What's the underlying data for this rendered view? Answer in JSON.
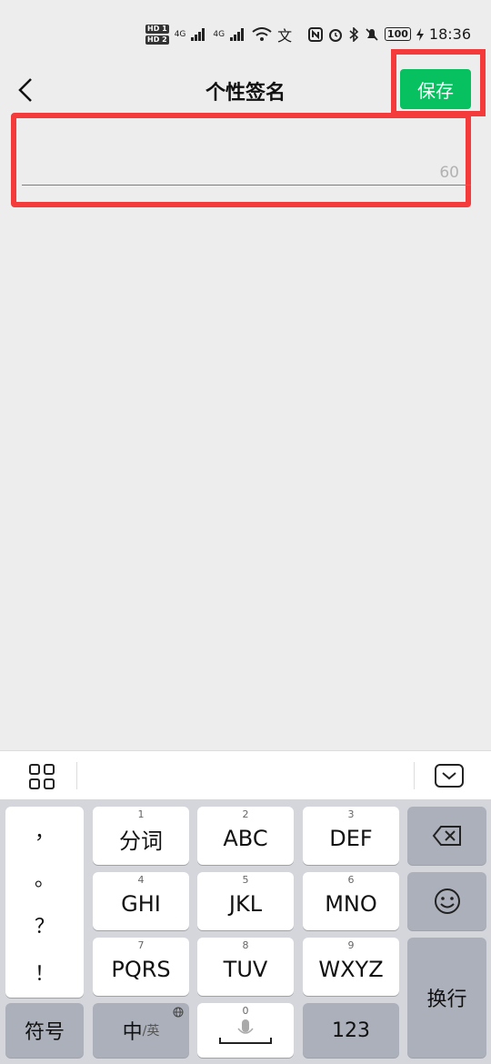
{
  "status_bar": {
    "hd1": "HD 1",
    "hd2": "HD 2",
    "sig1": "4G",
    "sig2": "4G",
    "wifi_icon": "wifi-icon",
    "extra": "文",
    "battery": "100",
    "time": "18:36"
  },
  "header": {
    "title": "个性签名",
    "save_label": "保存"
  },
  "input": {
    "value": "",
    "counter": "60"
  },
  "keyboard": {
    "punct": [
      "，",
      "。",
      "？",
      "！"
    ],
    "row1": [
      {
        "num": "1",
        "label": "分词"
      },
      {
        "num": "2",
        "label": "ABC"
      },
      {
        "num": "3",
        "label": "DEF"
      }
    ],
    "row2": [
      {
        "num": "4",
        "label": "GHI"
      },
      {
        "num": "5",
        "label": "JKL"
      },
      {
        "num": "6",
        "label": "MNO"
      }
    ],
    "row3": [
      {
        "num": "7",
        "label": "PQRS"
      },
      {
        "num": "8",
        "label": "TUV"
      },
      {
        "num": "9",
        "label": "WXYZ"
      }
    ],
    "symbols_label": "符号",
    "zh_label": "中",
    "en_sub": "/英",
    "space_num": "0",
    "num_label": "123",
    "enter_label": "换行"
  },
  "colors": {
    "accent": "#07c160",
    "highlight": "#f43a3a"
  }
}
